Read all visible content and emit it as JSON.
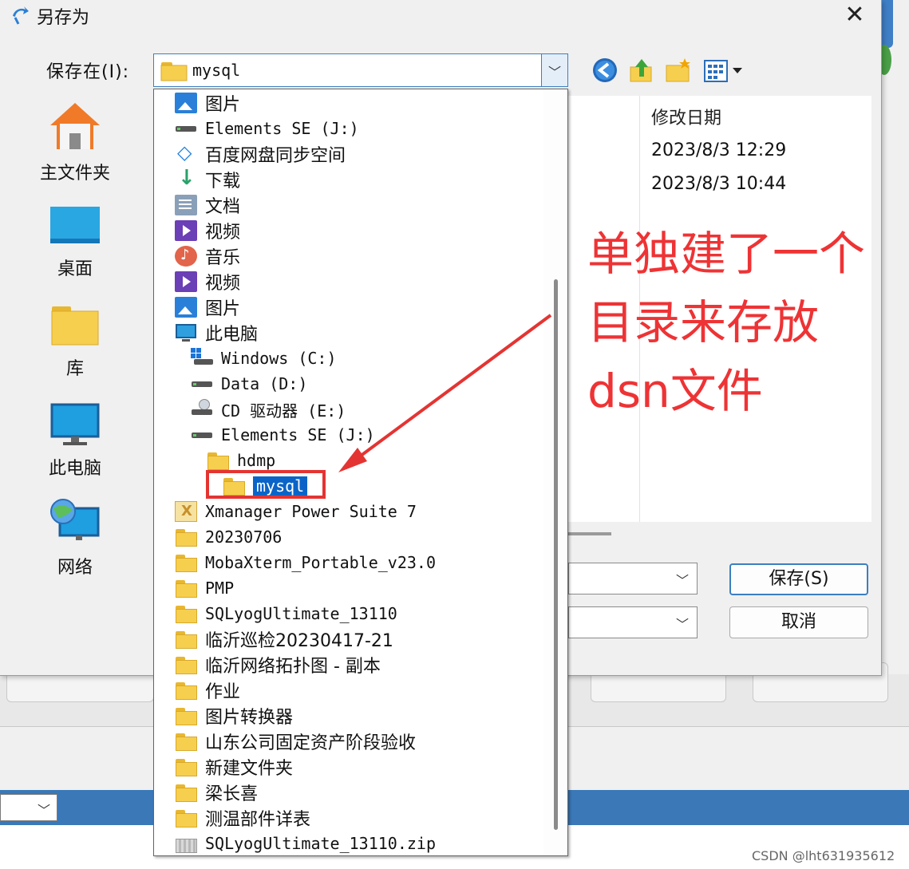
{
  "dialog": {
    "title": "另存为",
    "close_glyph": "✕",
    "save_in_label": "保存在(I):",
    "save_in_value": "mysql"
  },
  "places": [
    {
      "label": "主文件夹",
      "icon": "home-icon"
    },
    {
      "label": "桌面",
      "icon": "desktop-icon"
    },
    {
      "label": "库",
      "icon": "library-folder-icon"
    },
    {
      "label": "此电脑",
      "icon": "computer-icon"
    },
    {
      "label": "网络",
      "icon": "network-icon"
    }
  ],
  "file_list": {
    "column_header": "修改日期",
    "dates": [
      "2023/8/3 12:29",
      "2023/8/3 10:44"
    ]
  },
  "buttons": {
    "save": "保存(S)",
    "cancel": "取消"
  },
  "dropdown_items": [
    {
      "label": "图片",
      "icon": "pictures-icon",
      "indent": 0,
      "mono": false
    },
    {
      "label": "Elements SE (J:)",
      "icon": "drive-icon",
      "indent": 0,
      "mono": true
    },
    {
      "label": "百度网盘同步空间",
      "icon": "baidu-netdisk-icon",
      "indent": 0,
      "mono": false
    },
    {
      "label": "下载",
      "icon": "download-icon",
      "indent": 0,
      "mono": false
    },
    {
      "label": "文档",
      "icon": "document-icon",
      "indent": 0,
      "mono": false
    },
    {
      "label": "视频",
      "icon": "video-icon",
      "indent": 0,
      "mono": false
    },
    {
      "label": "音乐",
      "icon": "music-icon",
      "indent": 0,
      "mono": false
    },
    {
      "label": "视频",
      "icon": "video-icon",
      "indent": 0,
      "mono": false
    },
    {
      "label": "图片",
      "icon": "pictures-icon",
      "indent": 0,
      "mono": false
    },
    {
      "label": "此电脑",
      "icon": "computer-icon",
      "indent": 0,
      "mono": false
    },
    {
      "label": "Windows (C:)",
      "icon": "windows-drive-icon",
      "indent": 1,
      "mono": true
    },
    {
      "label": "Data (D:)",
      "icon": "drive-icon",
      "indent": 1,
      "mono": true
    },
    {
      "label": "CD 驱动器 (E:)",
      "icon": "cd-drive-icon",
      "indent": 1,
      "mono": true
    },
    {
      "label": "Elements SE (J:)",
      "icon": "drive-icon",
      "indent": 1,
      "mono": true
    },
    {
      "label": "hdmp",
      "icon": "folder-icon",
      "indent": 2,
      "mono": true
    },
    {
      "label": "mysql",
      "icon": "folder-icon",
      "indent": 3,
      "mono": true,
      "selected": true
    },
    {
      "label": "Xmanager Power Suite 7",
      "icon": "xmanager-icon",
      "indent": 0,
      "mono": true
    },
    {
      "label": "20230706",
      "icon": "folder-icon",
      "indent": 0,
      "mono": true
    },
    {
      "label": "MobaXterm_Portable_v23.0",
      "icon": "folder-icon",
      "indent": 0,
      "mono": true
    },
    {
      "label": "PMP",
      "icon": "folder-icon",
      "indent": 0,
      "mono": true
    },
    {
      "label": "SQLyogUltimate_13110",
      "icon": "folder-icon",
      "indent": 0,
      "mono": true
    },
    {
      "label": "临沂巡检20230417-21",
      "icon": "folder-icon",
      "indent": 0,
      "mono": false
    },
    {
      "label": "临沂网络拓扑图 - 副本",
      "icon": "folder-icon",
      "indent": 0,
      "mono": false
    },
    {
      "label": "作业",
      "icon": "folder-icon",
      "indent": 0,
      "mono": false
    },
    {
      "label": "图片转换器",
      "icon": "folder-icon",
      "indent": 0,
      "mono": false
    },
    {
      "label": "山东公司固定资产阶段验收",
      "icon": "folder-icon",
      "indent": 0,
      "mono": false
    },
    {
      "label": "新建文件夹",
      "icon": "folder-icon",
      "indent": 0,
      "mono": false
    },
    {
      "label": "梁长喜",
      "icon": "folder-icon",
      "indent": 0,
      "mono": false
    },
    {
      "label": "测温部件详表",
      "icon": "folder-icon",
      "indent": 0,
      "mono": false
    },
    {
      "label": "SQLyogUltimate_13110.zip",
      "icon": "zip-folder-icon",
      "indent": 0,
      "mono": true
    }
  ],
  "annotation": {
    "lines": [
      "单独建了一个",
      "目录来存放",
      "dsn文件"
    ],
    "color": "#ee3335"
  },
  "watermark": "CSDN @lht631935612",
  "colors": {
    "selection": "#0a64c8",
    "accent_border": "#3c7fc1",
    "background_bar": "#3a78b8"
  }
}
